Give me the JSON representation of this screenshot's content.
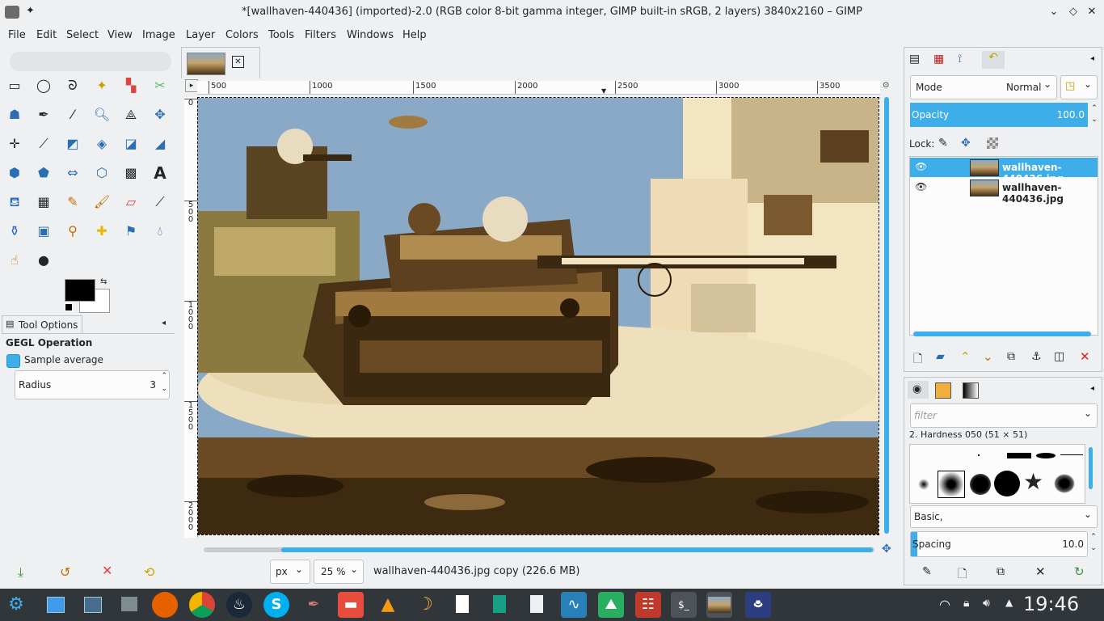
{
  "window": {
    "title": "*[wallhaven-440436] (imported)-2.0 (RGB color 8-bit gamma integer, GIMP built-in sRGB, 2 layers) 3840x2160 – GIMP"
  },
  "menubar": [
    "File",
    "Edit",
    "Select",
    "View",
    "Image",
    "Layer",
    "Colors",
    "Tools",
    "Filters",
    "Windows",
    "Help"
  ],
  "tool_options": {
    "tab_label": "Tool Options",
    "section_title": "GEGL Operation",
    "sample_average_label": "Sample average",
    "sample_average_checked": true,
    "radius_label": "Radius",
    "radius_value": "3"
  },
  "canvas": {
    "ruler_h_ticks": [
      "500",
      "1000",
      "1500",
      "2000",
      "2500",
      "3000",
      "3500"
    ],
    "ruler_v_ticks": [
      "0",
      "5\n0\n0",
      "1\n0\n0\n0",
      "1\n5\n0\n0",
      "2\n0\n0\n0"
    ],
    "status": {
      "unit": "px",
      "zoom": "25 %",
      "info": "wallhaven-440436.jpg copy (226.6 MB)"
    }
  },
  "layers_panel": {
    "mode_label": "Mode",
    "mode_value": "Normal",
    "opacity_label": "Opacity",
    "opacity_value": "100.0",
    "lock_label": "Lock:",
    "layers": [
      {
        "name": "wallhaven-440436.jpg",
        "visible": true,
        "selected": true
      },
      {
        "name": "wallhaven-440436.jpg",
        "visible": true,
        "selected": false
      }
    ]
  },
  "brushes_panel": {
    "filter_placeholder": "filter",
    "brush_name": "2. Hardness 050 (51 × 51)",
    "preset_value": "Basic,",
    "spacing_label": "Spacing",
    "spacing_value": "10.0"
  },
  "taskbar": {
    "clock": "19:46"
  },
  "colors": {
    "accent": "#3daee9",
    "window_bg": "#eff0f1",
    "taskbar_bg": "#31363b"
  }
}
